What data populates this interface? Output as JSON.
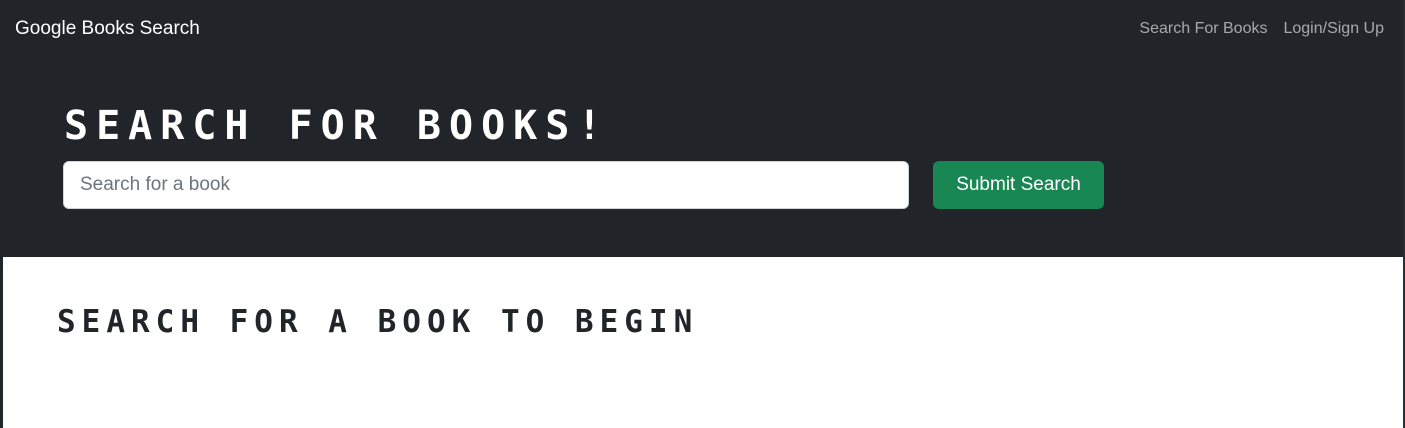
{
  "navbar": {
    "brand": "Google Books Search",
    "links": [
      {
        "label": "Search For Books"
      },
      {
        "label": "Login/Sign Up"
      }
    ]
  },
  "hero": {
    "title": "SEARCH FOR BOOKS!",
    "search": {
      "placeholder": "Search for a book",
      "value": ""
    },
    "submit_label": "Submit Search"
  },
  "results": {
    "heading": "SEARCH FOR A BOOK TO BEGIN"
  },
  "colors": {
    "dark_bg": "#212529",
    "button_green": "#198754",
    "nav_link": "rgba(255,255,255,0.6)"
  }
}
